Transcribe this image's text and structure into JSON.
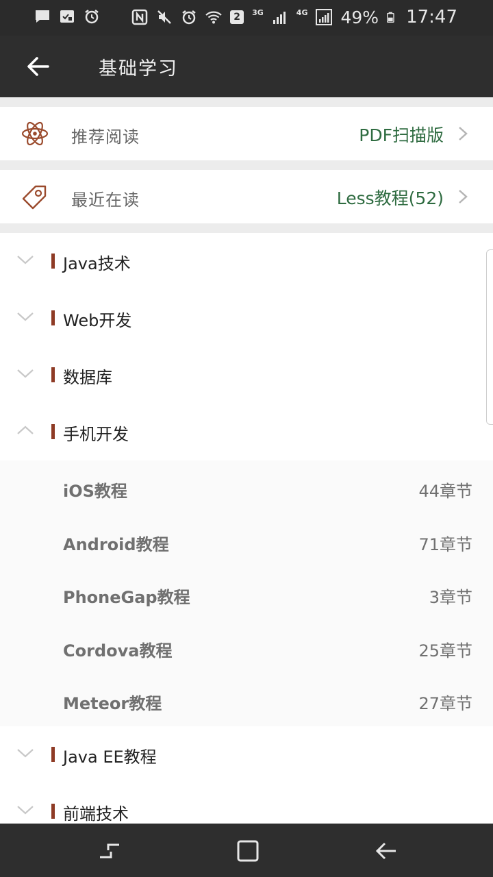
{
  "status_bar": {
    "battery_percent": "49%",
    "time": "17:47",
    "notification_count": "2",
    "network_3g": "3G",
    "network_4g": "4G"
  },
  "app_bar": {
    "title": "基础学习",
    "back_icon": "arrow-back-icon"
  },
  "quick_links": [
    {
      "icon": "atom-icon",
      "label": "推荐阅读",
      "value": "PDF扫描版"
    },
    {
      "icon": "tag-icon",
      "label": "最近在读",
      "value": "Less教程(52)"
    }
  ],
  "categories": [
    {
      "name": "Java技术",
      "expanded": false
    },
    {
      "name": "Web开发",
      "expanded": false
    },
    {
      "name": "数据库",
      "expanded": false
    },
    {
      "name": "手机开发",
      "expanded": true,
      "items": [
        {
          "name": "iOS教程",
          "count": "44章节"
        },
        {
          "name": "Android教程",
          "count": "71章节"
        },
        {
          "name": "PhoneGap教程",
          "count": "3章节"
        },
        {
          "name": "Cordova教程",
          "count": "25章节"
        },
        {
          "name": "Meteor教程",
          "count": "27章节"
        }
      ]
    },
    {
      "name": "Java EE教程",
      "expanded": false
    },
    {
      "name": "前端技术",
      "expanded": false
    }
  ],
  "colors": {
    "accent_green": "#2e6b40",
    "accent_red": "#8e3b25",
    "app_bar": "#2e2e2e"
  }
}
